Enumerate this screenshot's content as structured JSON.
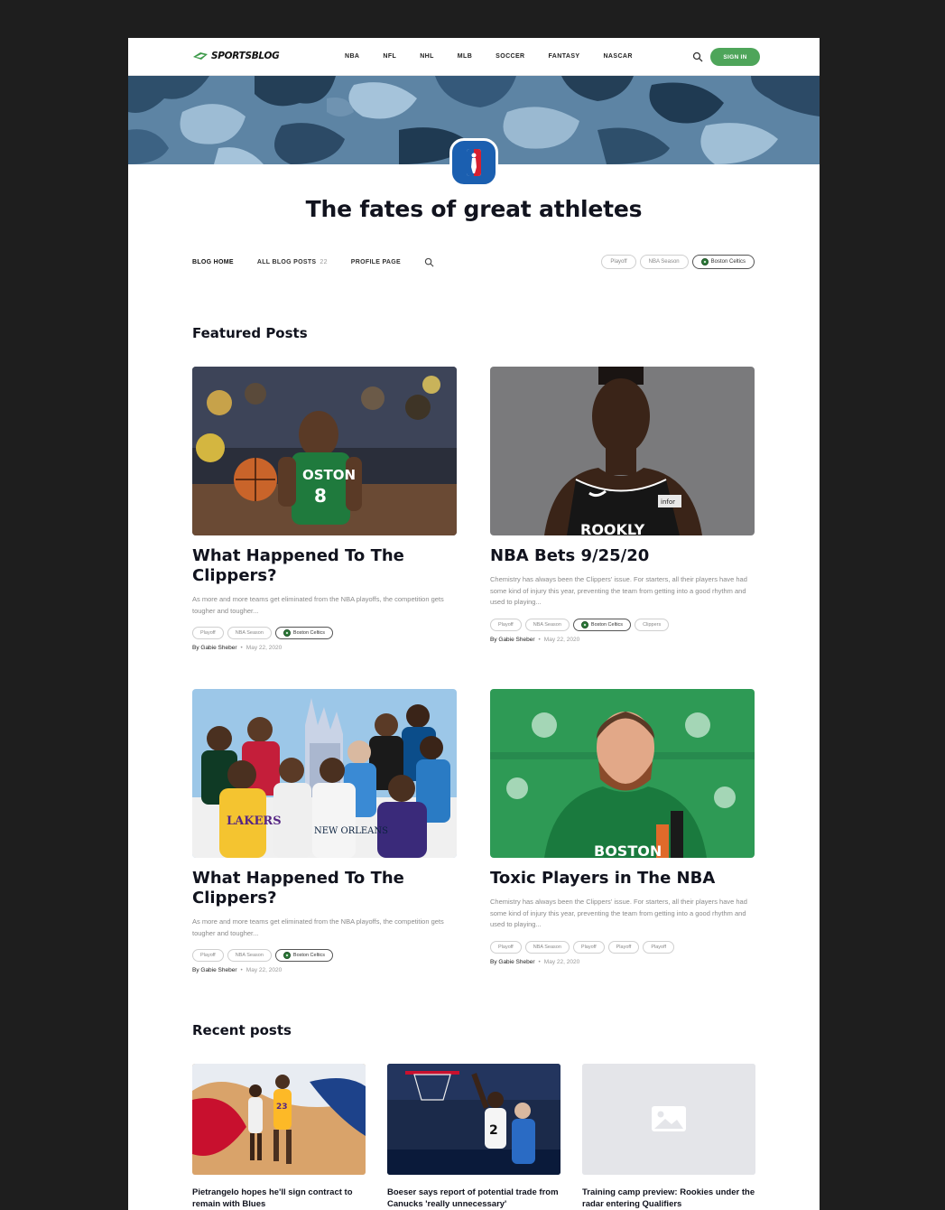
{
  "header": {
    "logo_text": "SPORTSBLOG",
    "nav": [
      "NBA",
      "NFL",
      "NHL",
      "MLB",
      "SOCCER",
      "FANTASY",
      "NASCAR"
    ],
    "sign_in": "SIGN IN"
  },
  "blog": {
    "title": "The fates of great athletes",
    "nav": {
      "home": "BLOG HOME",
      "all_posts": "ALL BLOG POSTS",
      "all_posts_count": "22",
      "profile": "PROFILE PAGE"
    },
    "filter_tags": [
      "Playoff",
      "NBA Season",
      "Boston Celtics"
    ]
  },
  "featured": {
    "heading": "Featured Posts",
    "posts": [
      {
        "title": "What Happened To The Clippers?",
        "excerpt": "As more and more teams get eliminated from the NBA playoffs, the competition gets tougher and tougher...",
        "tags": [
          "Playoff",
          "NBA Season",
          "Boston Celtics"
        ],
        "author": "By Gabie Sheber",
        "date": "May 22, 2020"
      },
      {
        "title": "NBA Bets 9/25/20",
        "excerpt": "Chemistry has always been the Clippers' issue. For starters, all their players have had some kind of injury this year, preventing the team from getting into a good rhythm and used to playing...",
        "tags": [
          "Playoff",
          "NBA Season",
          "Boston Celtics",
          "Clippers"
        ],
        "author": "By Gabie Sheber",
        "date": "May 22, 2020"
      },
      {
        "title": "What Happened To The Clippers?",
        "excerpt": "As more and more teams get eliminated from the NBA playoffs, the competition gets tougher and tougher...",
        "tags": [
          "Playoff",
          "NBA Season",
          "Boston Celtics"
        ],
        "author": "By Gabie Sheber",
        "date": "May 22, 2020"
      },
      {
        "title": "Toxic Players in The NBA",
        "excerpt": "Chemistry has always been the Clippers' issue. For starters, all their players have had some kind of injury this year, preventing the team from getting into a good rhythm and used to playing...",
        "tags": [
          "Playoff",
          "NBA Season",
          "Playoff",
          "Playoff",
          "Playoff"
        ],
        "author": "By Gabie Sheber",
        "date": "May 22, 2020"
      }
    ]
  },
  "recent": {
    "heading": "Recent posts",
    "posts": [
      {
        "title": "Pietrangelo hopes he'll sign contract to remain with Blues"
      },
      {
        "title": "Boeser says report of potential trade from Canucks 'really unnecessary'"
      },
      {
        "title": "Training camp preview: Rookies under the radar entering Qualifiers"
      }
    ]
  },
  "colors": {
    "brand_green": "#4ea55a",
    "banner_blue": "#5f86a6",
    "nba_blue": "#1b5fb0",
    "celtics_green": "#2f7d3b",
    "page_background": "#1e1e1e"
  }
}
